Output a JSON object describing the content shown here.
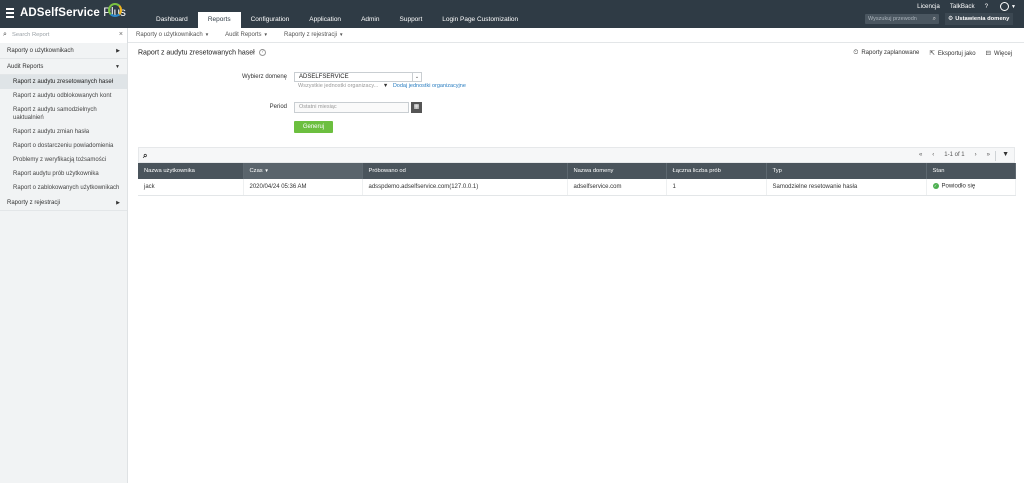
{
  "app": {
    "brand_name": "ADSelfService",
    "brand_plus": "Plus"
  },
  "header": {
    "tabs": [
      {
        "label": "Dashboard"
      },
      {
        "label": "Reports"
      },
      {
        "label": "Configuration"
      },
      {
        "label": "Application"
      },
      {
        "label": "Admin"
      },
      {
        "label": "Support"
      },
      {
        "label": "Login Page Customization"
      }
    ],
    "active_tab": "Reports",
    "links": {
      "license": "Licencja",
      "talkback": "TalkBack",
      "help": "?"
    },
    "search_placeholder": "Wyszukuj przewodn",
    "domain_settings": "Ustawienia domeny"
  },
  "subnav": {
    "search_placeholder": "Search Report",
    "menus": [
      {
        "label": "Raporty o użytkownikach"
      },
      {
        "label": "Audit Reports"
      },
      {
        "label": "Raporty z rejestracji"
      }
    ]
  },
  "sidebar": {
    "group_users": "Raporty o użytkownikach",
    "group_audit": "Audit Reports",
    "items": [
      {
        "label": "Raport z audytu zresetowanych haseł"
      },
      {
        "label": "Raport z audytu odblokowanych kont"
      },
      {
        "label": "Raport z audytu samodzielnych uaktualnień"
      },
      {
        "label": "Raport z audytu zmian hasła"
      },
      {
        "label": "Raport o dostarczeniu powiadomienia"
      },
      {
        "label": "Problemy z weryfikacją tożsamości"
      },
      {
        "label": "Raport audytu prób użytkownika"
      },
      {
        "label": "Raport o zablokowanych użytkownikach"
      }
    ],
    "group_enrollment": "Raporty z rejestracji"
  },
  "page": {
    "title": "Raport z audytu zresetowanych haseł",
    "help": "?",
    "actions": {
      "scheduled": "Raporty zaplanowane",
      "export": "Eksportuj jako",
      "more": "Więcej"
    }
  },
  "form": {
    "domain_label": "Wybierz domenę",
    "domain_value": "ADSELFSERVICE",
    "ou_placeholder": "Wszystkie jednostki organizacy...",
    "add_ou": "Dodaj jednostki organizacyjne",
    "period_label": "Period",
    "period_placeholder": "Ostatni miesiąc",
    "generate": "Generuj"
  },
  "grid": {
    "pager": {
      "first": "«",
      "prev": "‹",
      "range": "1-1 of 1",
      "next": "›",
      "last": "»"
    },
    "columns": [
      "Nazwa użytkownika",
      "Czas",
      "Próbowano od",
      "Nazwa domeny",
      "Łączna liczba prób",
      "Typ",
      "Stan"
    ],
    "sort_indicator": "▼",
    "rows": [
      {
        "user": "jack",
        "time": "2020/04/24 05:36 AM",
        "attempted_from": "adsspdemo.adselfservice.com(127.0.0.1)",
        "domain": "adselfservice.com",
        "attempts": "1",
        "type": "Samodzielne resetowanie hasła",
        "status": "Powiodło się"
      }
    ]
  },
  "colors": {
    "topbar": "#2f3b45",
    "accent_green": "#6cbf3f",
    "table_header": "#4a545c",
    "link_blue": "#2a7ec1",
    "success": "#4caf50"
  },
  "icons": [
    "hamburger-icon",
    "search-icon",
    "close-icon",
    "user-icon",
    "gear-icon",
    "help-icon",
    "schedule-icon",
    "export-icon",
    "more-icon",
    "calendar-icon",
    "filter-icon",
    "success-icon"
  ]
}
